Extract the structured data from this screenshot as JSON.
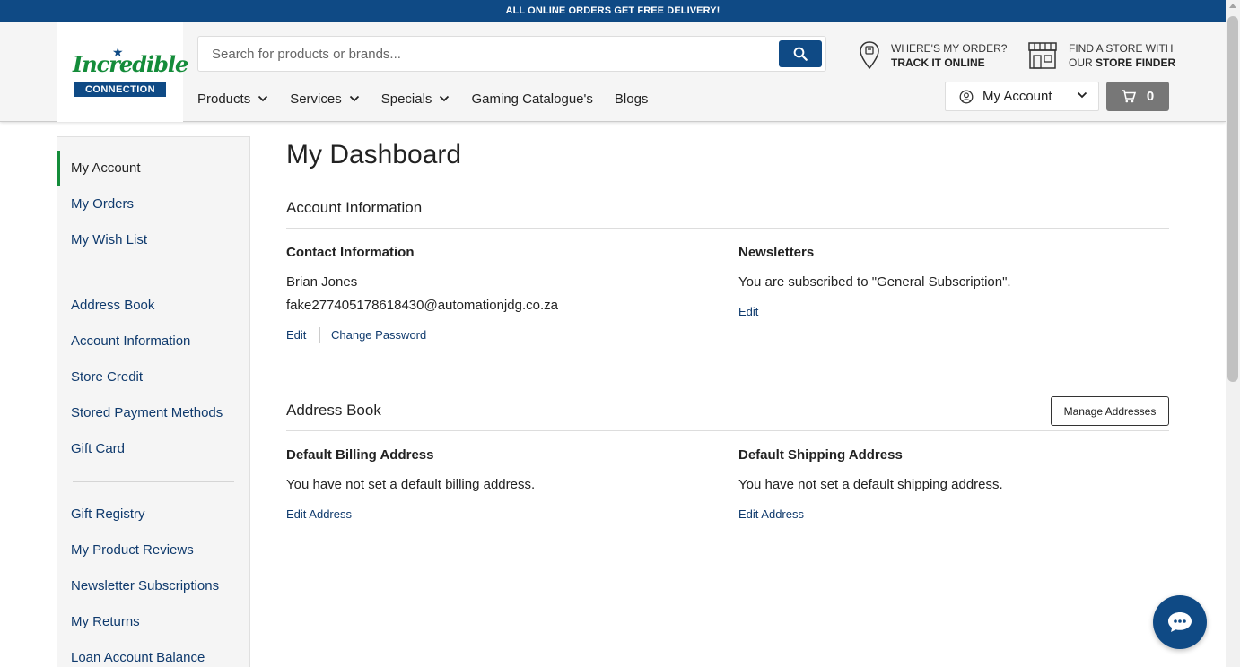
{
  "promo": {
    "text": "ALL ONLINE ORDERS GET FREE DELIVERY!"
  },
  "header": {
    "logo": {
      "word": "Incredible",
      "bar": "CONNECTION"
    },
    "search": {
      "placeholder": "Search for products or brands..."
    },
    "track": {
      "line1": "WHERE'S MY ORDER?",
      "line2": "TRACK IT ONLINE"
    },
    "store": {
      "line1": "FIND A STORE WITH",
      "line2_prefix": "OUR",
      "line2_bold": "STORE FINDER"
    },
    "nav": [
      {
        "label": "Products",
        "dropdown": true
      },
      {
        "label": "Services",
        "dropdown": true
      },
      {
        "label": "Specials",
        "dropdown": true
      },
      {
        "label": "Gaming Catalogue's",
        "dropdown": false
      },
      {
        "label": "Blogs",
        "dropdown": false
      }
    ],
    "account_label": "My Account",
    "cart_count": "0"
  },
  "sidebar": {
    "items": [
      {
        "label": "My Account",
        "active": true
      },
      {
        "label": "My Orders"
      },
      {
        "label": "My Wish List"
      },
      {
        "label": "Address Book"
      },
      {
        "label": "Account Information"
      },
      {
        "label": "Store Credit"
      },
      {
        "label": "Stored Payment Methods"
      },
      {
        "label": "Gift Card"
      },
      {
        "label": "Gift Registry"
      },
      {
        "label": "My Product Reviews"
      },
      {
        "label": "Newsletter Subscriptions"
      },
      {
        "label": "My Returns"
      },
      {
        "label": "Loan Account Balance"
      }
    ]
  },
  "main": {
    "title": "My Dashboard",
    "account_info": {
      "heading": "Account Information",
      "contact": {
        "heading": "Contact Information",
        "name": "Brian Jones",
        "email": "fake277405178618430@automationjdg.co.za",
        "edit": "Edit",
        "change_password": "Change Password"
      },
      "newsletters": {
        "heading": "Newsletters",
        "text": "You are subscribed to \"General Subscription\".",
        "edit": "Edit"
      }
    },
    "address_book": {
      "heading": "Address Book",
      "manage": "Manage Addresses",
      "billing": {
        "heading": "Default Billing Address",
        "text": "You have not set a default billing address.",
        "edit": "Edit Address"
      },
      "shipping": {
        "heading": "Default Shipping Address",
        "text": "You have not set a default shipping address.",
        "edit": "Edit Address"
      }
    }
  },
  "colors": {
    "brand_blue": "#0f4a85",
    "brand_green": "#148c3a",
    "link": "#0f3a6d"
  }
}
